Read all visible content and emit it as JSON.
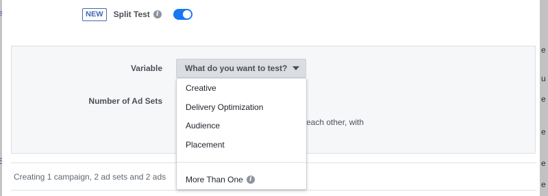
{
  "split_test": {
    "badge": "NEW",
    "label": "Split Test",
    "info_icon": "info-icon",
    "toggle_on": true,
    "toggle_color": "#1877f2"
  },
  "variable": {
    "label": "Variable",
    "select_value": "What do you want to test?",
    "options": [
      "Creative",
      "Delivery Optimization",
      "Audience",
      "Placement"
    ],
    "more_option": "More Than One"
  },
  "ad_sets": {
    "label": "Number of Ad Sets",
    "partial_text": "each other, with"
  },
  "footer": {
    "summary": "Creating 1 campaign, 2 ad sets and 2 ads"
  },
  "background": {
    "left_fragments": [
      "a",
      "S"
    ],
    "right_fragments": [
      "e",
      "u",
      "e",
      "e",
      "e",
      "e"
    ]
  },
  "colors": {
    "accent": "#4267b2",
    "panel_bg": "#f6f7f9"
  }
}
